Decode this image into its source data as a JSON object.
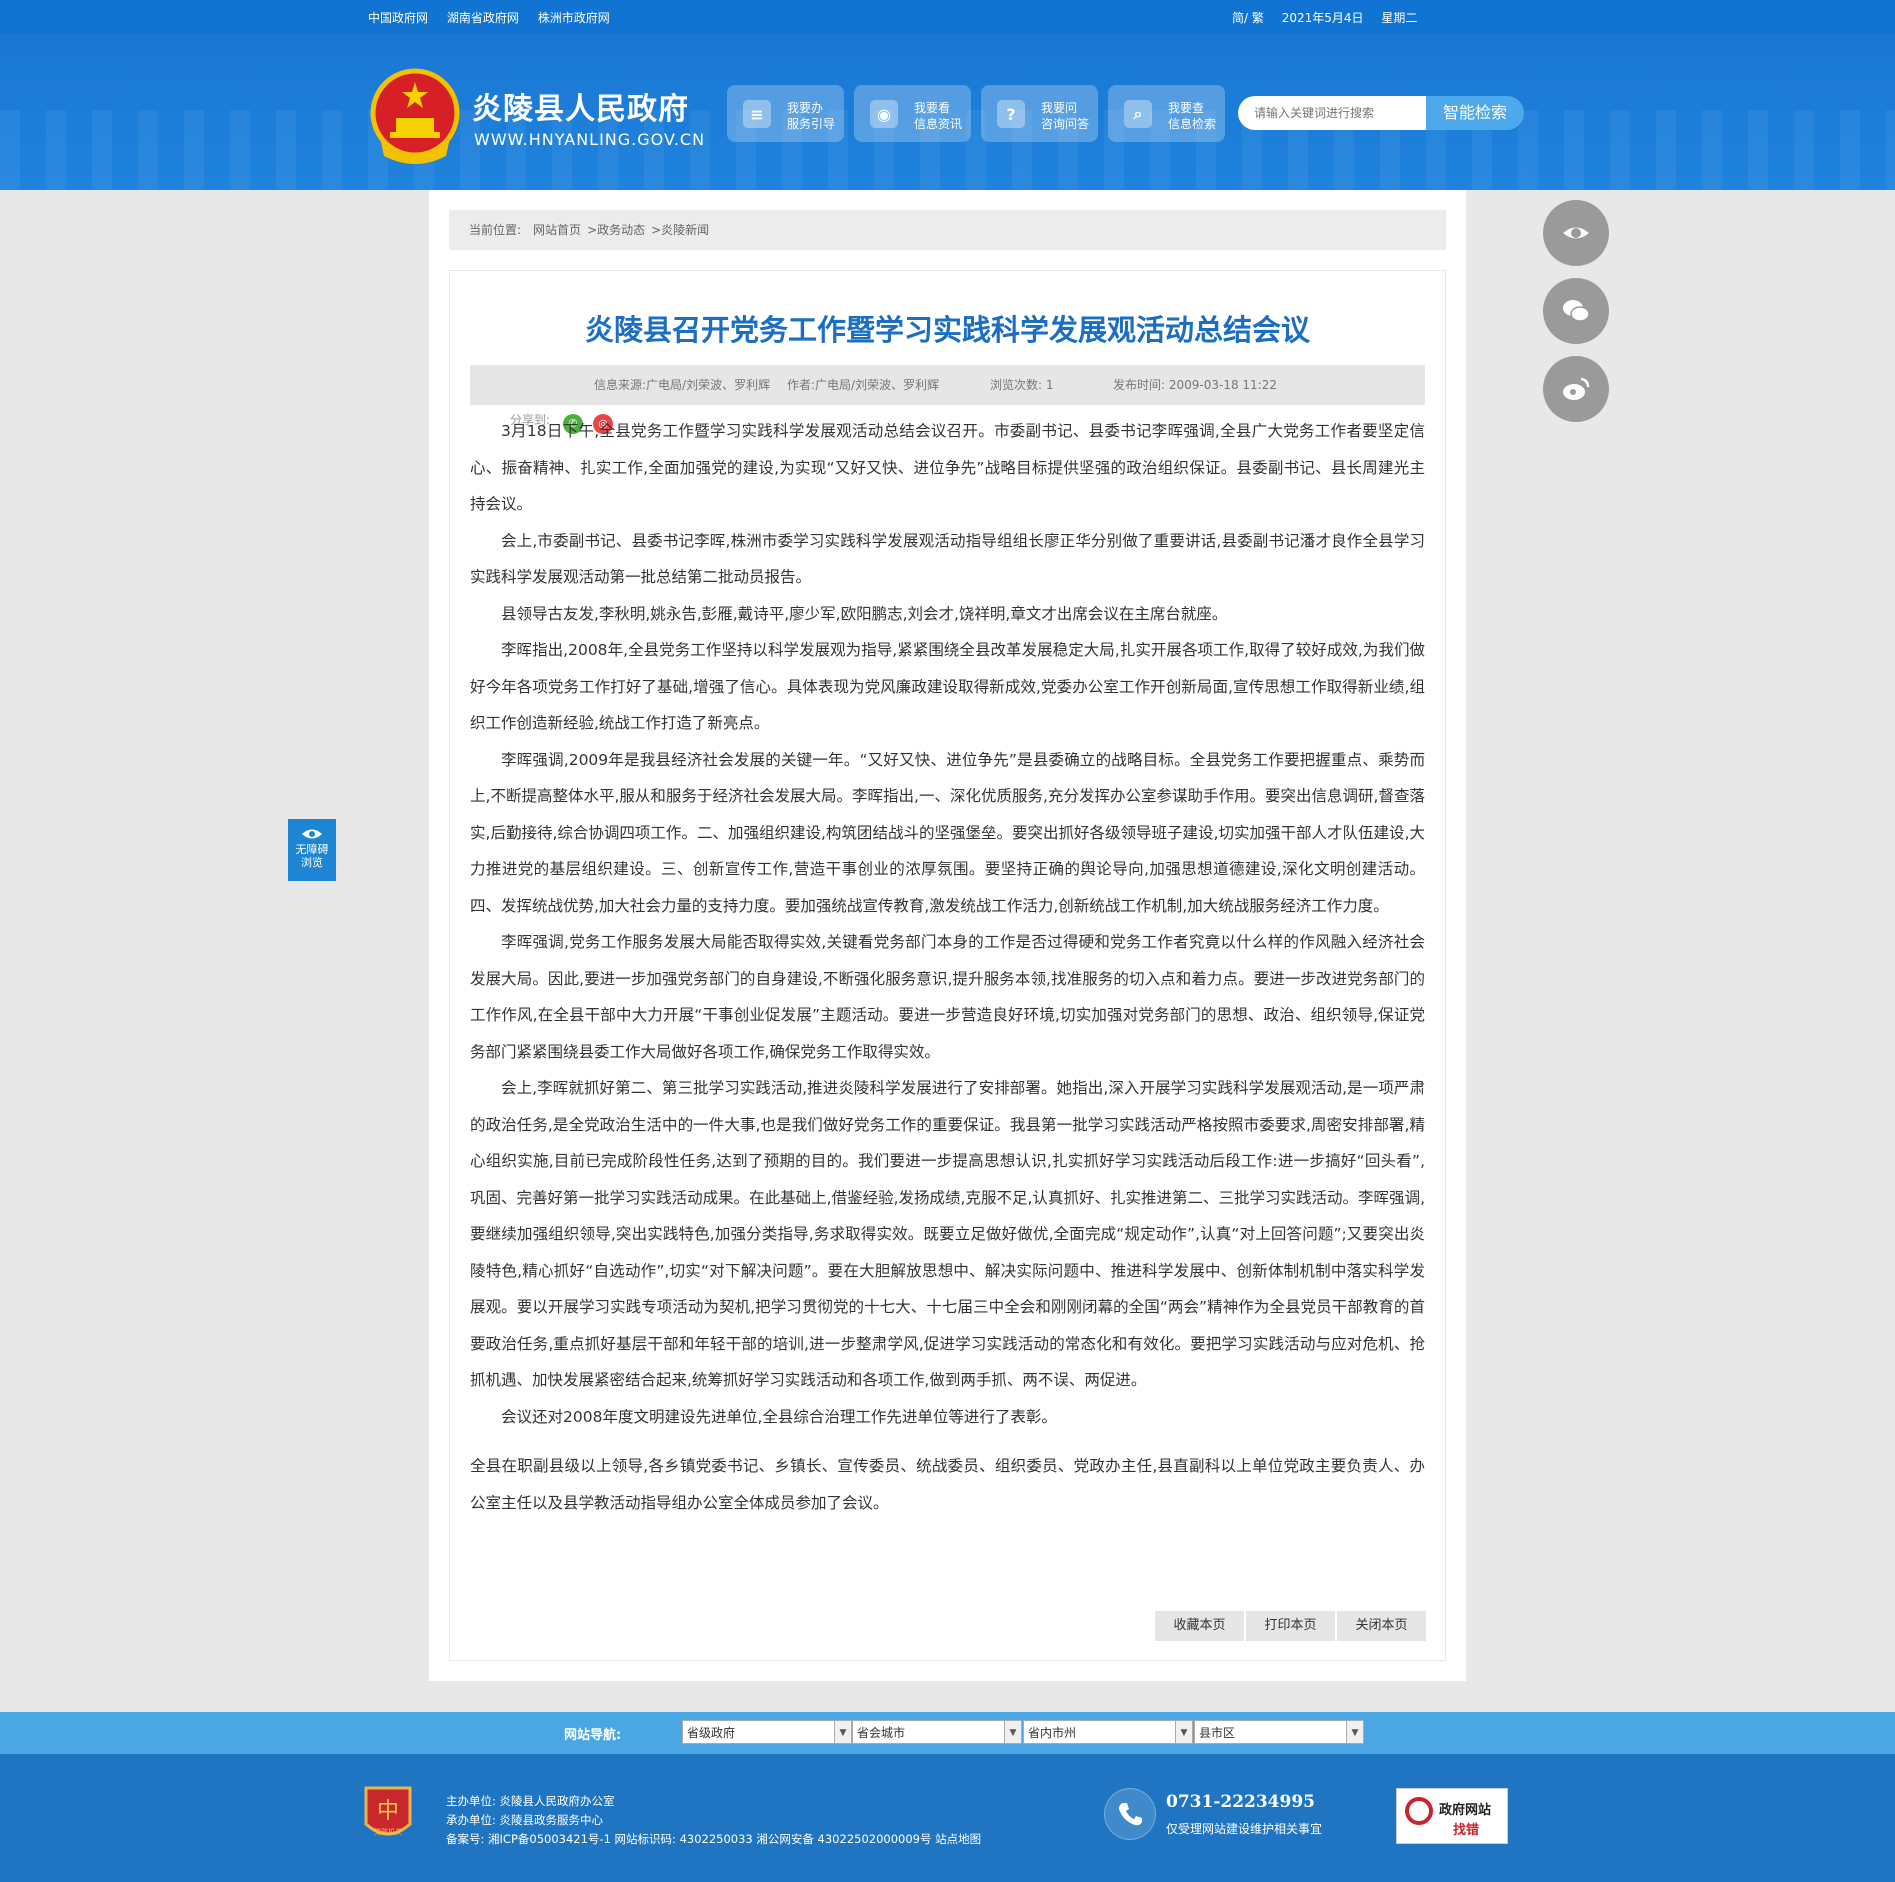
{
  "top_links": [
    "中国政府网",
    "湖南省政府网",
    "株洲市政府网"
  ],
  "top_right": {
    "lang": "简/ 繁",
    "date": "2021年5月4日",
    "weekday": "星期二"
  },
  "header": {
    "site_title": "炎陵县人民政府",
    "site_url": "WWW.HNYANLING.GOV.CN",
    "buttons": [
      {
        "icon": "form-icon",
        "line1": "我要办",
        "line2": "服务引导"
      },
      {
        "icon": "eye-icon",
        "line1": "我要看",
        "line2": "信息资讯"
      },
      {
        "icon": "question-icon",
        "line1": "我要问",
        "line2": "咨询问答"
      },
      {
        "icon": "search-icon",
        "line1": "我要查",
        "line2": "信息检索"
      }
    ],
    "search_placeholder": "请输入关键词进行搜索",
    "search_button": "智能检索"
  },
  "breadcrumb": {
    "label": "当前位置:",
    "items": [
      "网站首页",
      ">政务动态",
      ">炎陵新闻"
    ]
  },
  "article": {
    "title": "炎陵县召开党务工作暨学习实践科学发展观活动总结会议",
    "meta": {
      "source": "信息来源:广电局/刘荣波、罗利辉",
      "author": "作者:广电局/刘荣波、罗利辉",
      "views": "浏览次数: 1",
      "published": "发布时间: 2009-03-18 11:22"
    },
    "share_label": "分享到:",
    "paragraphs": [
      "3月18日下午,全县党务工作暨学习实践科学发展观活动总结会议召开。市委副书记、县委书记李晖强调,全县广大党务工作者要坚定信心、振奋精神、扎实工作,全面加强党的建设,为实现“又好又快、进位争先”战略目标提供坚强的政治组织保证。县委副书记、县长周建光主持会议。",
      "会上,市委副书记、县委书记李晖,株洲市委学习实践科学发展观活动指导组组长廖正华分别做了重要讲话,县委副书记潘才良作全县学习实践科学发展观活动第一批总结第二批动员报告。",
      "县领导古友发,李秋明,姚永告,彭雁,戴诗平,廖少军,欧阳鹏志,刘会才,饶祥明,章文才出席会议在主席台就座。",
      "李晖指出,2008年,全县党务工作坚持以科学发展观为指导,紧紧围绕全县改革发展稳定大局,扎实开展各项工作,取得了较好成效,为我们做好今年各项党务工作打好了基础,增强了信心。具体表现为党风廉政建设取得新成效,党委办公室工作开创新局面,宣传思想工作取得新业绩,组织工作创造新经验,统战工作打造了新亮点。",
      "李晖强调,2009年是我县经济社会发展的关键一年。“又好又快、进位争先”是县委确立的战略目标。全县党务工作要把握重点、乘势而上,不断提高整体水平,服从和服务于经济社会发展大局。李晖指出,一、深化优质服务,充分发挥办公室参谋助手作用。要突出信息调研,督查落实,后勤接待,综合协调四项工作。二、加强组织建设,构筑团结战斗的坚强堡垒。要突出抓好各级领导班子建设,切实加强干部人才队伍建设,大力推进党的基层组织建设。三、创新宣传工作,营造干事创业的浓厚氛围。要坚持正确的舆论导向,加强思想道德建设,深化文明创建活动。四、发挥统战优势,加大社会力量的支持力度。要加强统战宣传教育,激发统战工作活力,创新统战工作机制,加大统战服务经济工作力度。",
      "李晖强调,党务工作服务发展大局能否取得实效,关键看党务部门本身的工作是否过得硬和党务工作者究竟以什么样的作风融入经济社会发展大局。因此,要进一步加强党务部门的自身建设,不断强化服务意识,提升服务本领,找准服务的切入点和着力点。要进一步改进党务部门的工作作风,在全县干部中大力开展“干事创业促发展”主题活动。要进一步营造良好环境,切实加强对党务部门的思想、政治、组织领导,保证党务部门紧紧围绕县委工作大局做好各项工作,确保党务工作取得实效。",
      "会上,李晖就抓好第二、第三批学习实践活动,推进炎陵科学发展进行了安排部署。她指出,深入开展学习实践科学发展观活动,是一项严肃的政治任务,是全党政治生活中的一件大事,也是我们做好党务工作的重要保证。我县第一批学习实践活动严格按照市委要求,周密安排部署,精心组织实施,目前已完成阶段性任务,达到了预期的目的。我们要进一步提高思想认识,扎实抓好学习实践活动后段工作:进一步搞好“回头看”,巩固、完善好第一批学习实践活动成果。在此基础上,借鉴经验,发扬成绩,克服不足,认真抓好、扎实推进第二、三批学习实践活动。李晖强调,要继续加强组织领导,突出实践特色,加强分类指导,务求取得实效。既要立足做好做优,全面完成“规定动作”,认真“对上回答问题”;又要突出炎陵特色,精心抓好“自选动作”,切实“对下解决问题”。要在大胆解放思想中、解决实际问题中、推进科学发展中、创新体制机制中落实科学发展观。要以开展学习实践专项活动为契机,把学习贯彻党的十七大、十七届三中全会和刚刚闭幕的全国“两会”精神作为全县党员干部教育的首要政治任务,重点抓好基层干部和年轻干部的培训,进一步整肃学风,促进学习实践活动的常态化和有效化。要把学习实践活动与应对危机、抢抓机遇、加快发展紧密结合起来,统筹抓好学习实践活动和各项工作,做到两手抓、两不误、两促进。",
      "会议还对2008年度文明建设先进单位,全县综合治理工作先进单位等进行了表彰。"
    ],
    "closing": "全县在职副县级以上领导,各乡镇党委书记、乡镇长、宣传委员、统战委员、组织委员、党政办主任,县直副科以上单位党政主要负责人、办公室主任以及县学教活动指导组办公室全体成员参加了会议。",
    "actions": [
      "收藏本页",
      "打印本页",
      "关闭本页"
    ]
  },
  "side_floats": [
    "eye-icon",
    "wechat-icon",
    "weibo-icon"
  ],
  "accessibility": {
    "line1": "无障碍",
    "line2": "浏览"
  },
  "site_nav": {
    "label": "网站导航:",
    "selects": [
      "省级政府",
      "省会城市",
      "省内市州",
      "县市区"
    ]
  },
  "footer": {
    "host": "主办单位: 炎陵县人民政府办公室",
    "organizer": "承办单位: 炎陵县政务服务中心",
    "record": "备案号: 湘ICP备05003421号-1  网站标识码: 4302250033  湘公网安备 43022502000009号  站点地图",
    "badge_text": "党政机关",
    "phone": "0731-22234995",
    "phone_note": "仅受理网站建设维护相关事宜",
    "error_line1": "政府网站",
    "error_line2": "找错"
  },
  "colors": {
    "primary": "#1174d2",
    "title_blue": "#1b6ec2",
    "footer": "#1f75c2",
    "nav_strip": "#4aa7e3"
  }
}
